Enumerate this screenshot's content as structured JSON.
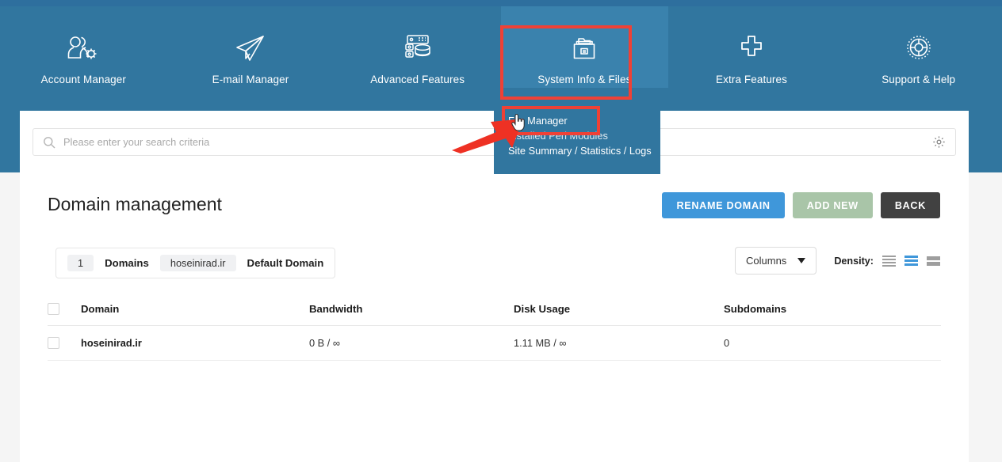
{
  "colors": {
    "header_blue": "#31769f",
    "header_blue_dark": "#2e6f9e",
    "nav_active": "#3a82ad",
    "highlight_red": "#ef4136",
    "primary_button": "#3f97da",
    "muted_button": "#a9c5a8",
    "dark_button": "#414141",
    "density_active": "#3f97da"
  },
  "nav": {
    "items": [
      {
        "label": "Account Manager",
        "icon": "users-gear-icon",
        "active": false
      },
      {
        "label": "E-mail Manager",
        "icon": "paper-plane-icon",
        "active": false
      },
      {
        "label": "Advanced Features",
        "icon": "database-icon",
        "active": false
      },
      {
        "label": "System Info & Files",
        "icon": "folder-files-icon",
        "active": true
      },
      {
        "label": "Extra Features",
        "icon": "plus-icon",
        "active": false
      },
      {
        "label": "Support & Help",
        "icon": "lifebuoy-icon",
        "active": false
      }
    ]
  },
  "dropdown": {
    "items": [
      {
        "label": "File Manager"
      },
      {
        "label": "Installed Perl Modules"
      },
      {
        "label": "Site Summary / Statistics / Logs"
      }
    ]
  },
  "search": {
    "placeholder": "Please enter your search criteria",
    "value": "",
    "icon": "search-icon",
    "settings_icon": "gear-icon"
  },
  "page": {
    "title": "Domain management"
  },
  "actions": {
    "rename": "RENAME DOMAIN",
    "add_new": "ADD NEW",
    "back": "BACK"
  },
  "info_bar": {
    "count": "1",
    "count_label": "Domains",
    "domain": "hoseinirad.ir",
    "default_label": "Default Domain"
  },
  "table_tools": {
    "columns_label": "Columns",
    "density_label": "Density:",
    "density_options": [
      "compact",
      "standard",
      "comfortable"
    ],
    "density_selected": "standard"
  },
  "table": {
    "columns": [
      "Domain",
      "Bandwidth",
      "Disk Usage",
      "Subdomains"
    ],
    "rows": [
      {
        "domain": "hoseinirad.ir",
        "bandwidth": "0 B / ∞",
        "disk_usage": "1.11 MB / ∞",
        "subdomains": "0"
      }
    ]
  },
  "annotations": {
    "arrow": "red-arrow-pointing-to-file-manager",
    "cursor": "hand-pointer-cursor"
  }
}
